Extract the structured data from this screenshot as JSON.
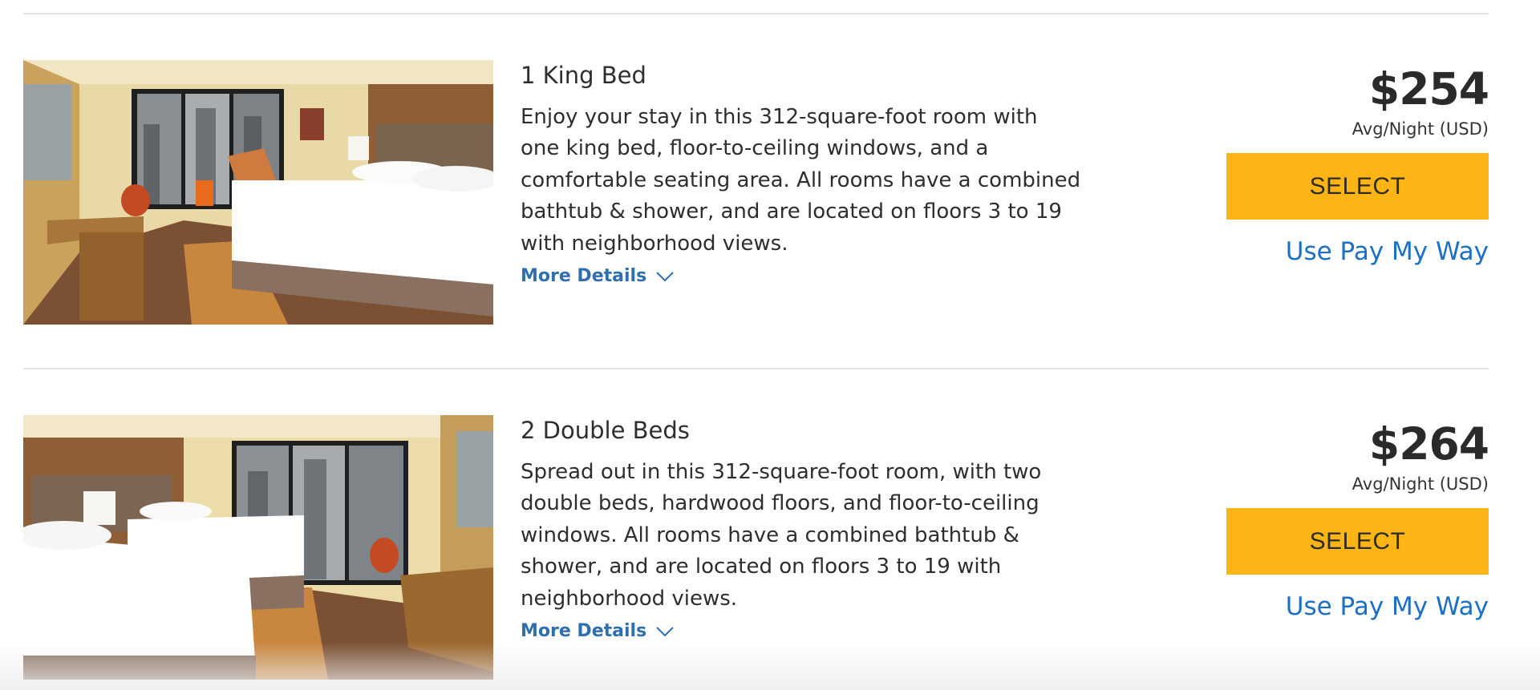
{
  "rooms": [
    {
      "title": "1 King Bed",
      "description": "Enjoy your stay in this 312-square-foot room with one king bed, floor-to-ceiling windows, and a comfortable seating area. All rooms have a combined bathtub & shower, and are located on floors 3 to 19 with neighborhood views.",
      "more_details_label": "More Details",
      "price": "$254",
      "price_sub": "Avg/Night (USD)",
      "select_label": "SELECT",
      "pay_my_way_label": "Use Pay My Way",
      "image_icon": "hotel-room-king-bed-photo"
    },
    {
      "title": "2 Double Beds",
      "description": "Spread out in this 312-square-foot room, with two double beds, hardwood floors, and floor-to-ceiling windows. All rooms have a combined bathtub & shower, and are located on floors 3 to 19 with neighborhood views.",
      "more_details_label": "More Details",
      "price": "$264",
      "price_sub": "Avg/Night (USD)",
      "select_label": "SELECT",
      "pay_my_way_label": "Use Pay My Way",
      "image_icon": "hotel-room-double-beds-photo"
    }
  ],
  "colors": {
    "select_button": "#fdb515",
    "link_blue": "#1b70c5",
    "more_details_blue": "#2f6fb0",
    "divider": "#e3e3e3"
  }
}
